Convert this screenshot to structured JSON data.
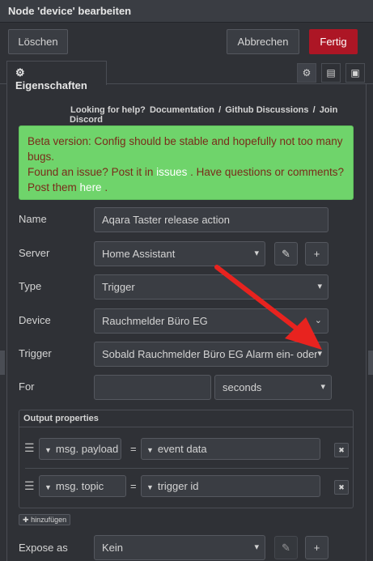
{
  "title": "Node 'device' bearbeiten",
  "toolbar": {
    "delete_label": "Löschen",
    "cancel_label": "Abbrechen",
    "done_label": "Fertig"
  },
  "tabs": {
    "properties_label": "Eigenschaften",
    "icons": [
      "gear-icon",
      "description-icon",
      "appearance-icon"
    ]
  },
  "help": {
    "prefix": "Looking for help?",
    "links": [
      "Documentation",
      "Github Discussions",
      "Join Discord"
    ],
    "separator": "/"
  },
  "beta": {
    "line1": "Beta version: Config should be stable and hopefully not too many bugs.",
    "line2a": "Found an issue? Post it in",
    "issues_link": "issues",
    "line2b": ". Have questions or comments? Post them",
    "here_link": "here",
    "line2c": "."
  },
  "form": {
    "name_label": "Name",
    "name_value": "Aqara Taster release action",
    "server_label": "Server",
    "server_value": "Home Assistant",
    "type_label": "Type",
    "type_value": "Trigger",
    "device_label": "Device",
    "device_value": "Rauchmelder Büro EG",
    "trigger_label": "Trigger",
    "trigger_value": "Sobald Rauchmelder Büro EG Alarm ein- oder",
    "for_label": "For",
    "for_value": "",
    "for_unit": "seconds",
    "expose_label": "Expose as",
    "expose_value": "Kein"
  },
  "output": {
    "title": "Output properties",
    "rows": [
      {
        "prefix": "msg.",
        "property": "payload",
        "eq": "=",
        "value": "event data"
      },
      {
        "prefix": "msg.",
        "property": "topic",
        "eq": "=",
        "value": "trigger id"
      }
    ],
    "add_label": "hinzufügen"
  },
  "colors": {
    "accent_red": "#ad1625",
    "beta_bg": "#6fd46b",
    "arrow": "#e8231f"
  }
}
